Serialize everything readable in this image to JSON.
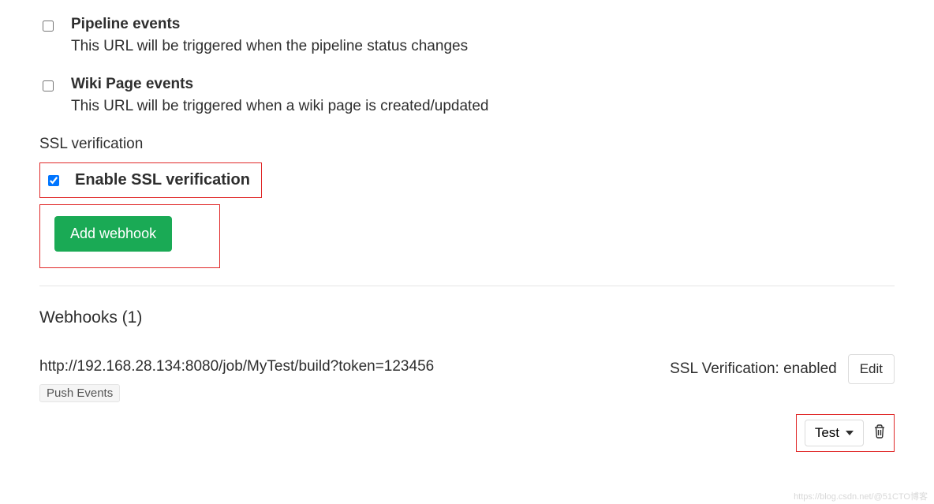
{
  "events": {
    "pipeline": {
      "title": "Pipeline events",
      "desc": "This URL will be triggered when the pipeline status changes"
    },
    "wiki": {
      "title": "Wiki Page events",
      "desc": "This URL will be triggered when a wiki page is created/updated"
    }
  },
  "ssl": {
    "heading": "SSL verification",
    "enable_label": "Enable SSL verification"
  },
  "buttons": {
    "add": "Add webhook",
    "edit": "Edit",
    "test": "Test"
  },
  "hooks": {
    "heading": "Webhooks (1)",
    "items": [
      {
        "url": "http://192.168.28.134:8080/job/MyTest/build?token=123456",
        "badge": "Push Events",
        "ssl_status": "SSL Verification: enabled"
      }
    ]
  },
  "watermark": "https://blog.csdn.net/@51CTO博客"
}
